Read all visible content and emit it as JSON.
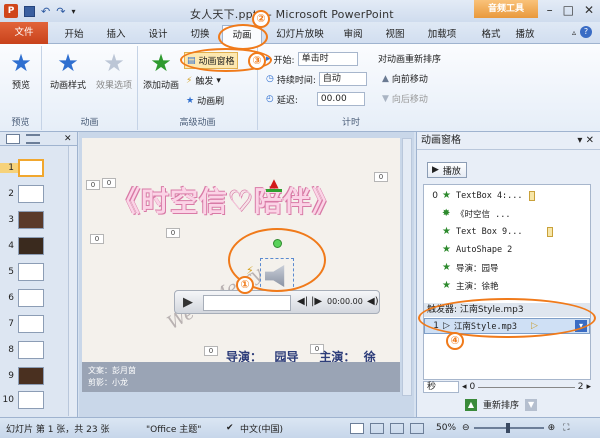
{
  "window": {
    "title": "女人天下.pptx - Microsoft PowerPoint",
    "context_tab": "音频工具"
  },
  "tabs": [
    {
      "label": "文件"
    },
    {
      "label": "开始"
    },
    {
      "label": "插入"
    },
    {
      "label": "设计"
    },
    {
      "label": "切换"
    },
    {
      "label": "动画"
    },
    {
      "label": "幻灯片放映"
    },
    {
      "label": "审阅"
    },
    {
      "label": "视图"
    },
    {
      "label": "加载项"
    },
    {
      "label": "格式"
    },
    {
      "label": "播放"
    }
  ],
  "ribbon": {
    "preview": {
      "btn": "预览",
      "group": "预览"
    },
    "animation": {
      "style": "动画样式",
      "effects": "效果选项",
      "group": "动画"
    },
    "advanced": {
      "add": "添加动画",
      "pane": "动画窗格",
      "trigger": "触发",
      "painter": "动画刷",
      "group": "高级动画"
    },
    "timing": {
      "start_label": "开始:",
      "start_val": "单击时",
      "dur_label": "持续时间:",
      "dur_val": "自动",
      "delay_label": "延迟:",
      "delay_val": "00.00",
      "group": "计时"
    },
    "reorder": {
      "title": "对动画重新排序",
      "forward": "向前移动",
      "backward": "向后移动"
    }
  },
  "left_pane": {
    "slide_numbers": [
      "1",
      "2",
      "3",
      "4",
      "5",
      "6",
      "7",
      "8",
      "9",
      "10"
    ]
  },
  "slide": {
    "title": "《时空信♡陪伴》",
    "credits1": "导演：   园导     主演：  徐",
    "audio_time": "00:00.00",
    "marker_labels": [
      "0",
      "0",
      "0",
      "0",
      "0",
      "0",
      "0"
    ],
    "sign": "We a'Merry",
    "notes_line1": "文案：彭月茵",
    "notes_line2": "剪影：小龙"
  },
  "anim_pane": {
    "title": "动画窗格",
    "play": "播放",
    "items": [
      {
        "num": "0",
        "label": "TextBox 4:..."
      },
      {
        "num": "",
        "label": "《时空信 ..."
      },
      {
        "num": "",
        "label": "Text Box 9..."
      },
      {
        "num": "",
        "label": "AutoShape 2"
      },
      {
        "num": "",
        "label": "导演：园导"
      },
      {
        "num": "",
        "label": "主演：徐艳"
      }
    ],
    "trigger": "触发器: 江南Style.mp3",
    "trigger_item": {
      "num": "1",
      "label": "江南Style.mp3"
    },
    "unit": "秒",
    "scale_from": "0",
    "scale_to": "2",
    "reorder": "重新排序"
  },
  "callouts": [
    "①",
    "②",
    "③",
    "④"
  ],
  "status": {
    "slide_info": "幻灯片 第 1 张，共 23 张",
    "theme": "\"Office 主题\"",
    "lang": "中文(中国)",
    "zoom": "50%"
  }
}
